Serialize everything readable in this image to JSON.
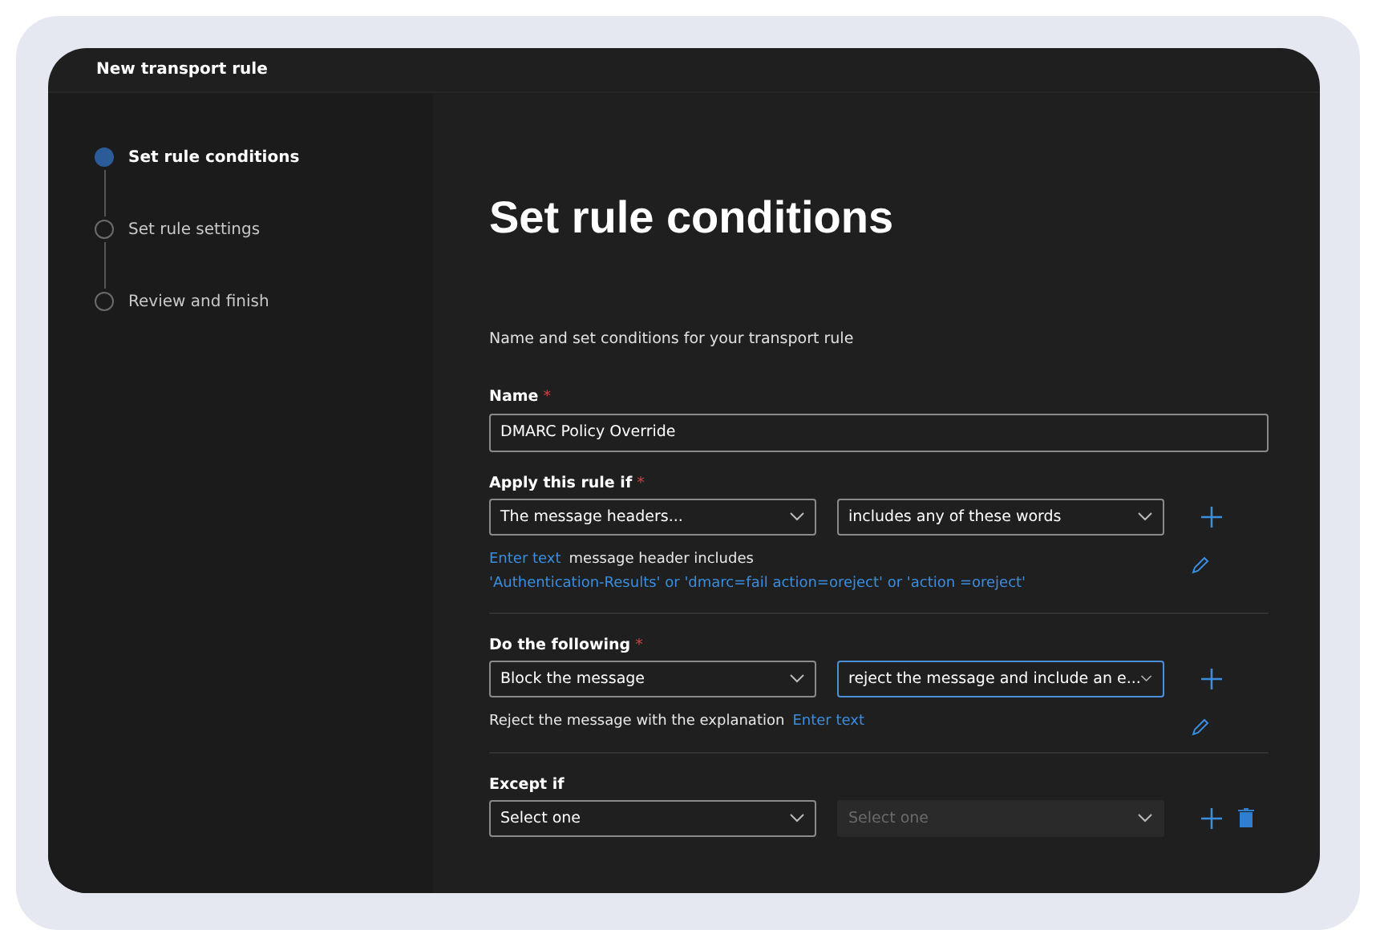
{
  "window": {
    "title": "New transport rule"
  },
  "steps": [
    {
      "label": "Set rule conditions",
      "selected": true
    },
    {
      "label": "Set rule settings",
      "selected": false
    },
    {
      "label": "Review and finish",
      "selected": false
    }
  ],
  "page": {
    "heading": "Set rule conditions",
    "description": "Name and set conditions for your transport rule"
  },
  "name_field": {
    "label": "Name",
    "required_mark": "*",
    "value": "DMARC Policy Override"
  },
  "sections": [
    {
      "label": "Apply this rule if",
      "required_mark": "*",
      "edit_icon": true,
      "icons": [
        {
          "kind": "add"
        }
      ],
      "dropdowns": [
        {
          "value": "The message headers...",
          "focused": false,
          "disabled": false
        },
        {
          "value": "includes any of these words",
          "focused": false,
          "disabled": false
        }
      ],
      "detail_lines": [
        [
          {
            "text": "Enter text",
            "link": true
          },
          {
            "text": "message header includes",
            "link": false
          }
        ],
        [
          {
            "text": "'Authentication-Results' or 'dmarc=fail action=oreject' or 'action =oreject'",
            "link": true
          }
        ]
      ]
    },
    {
      "label": "Do the following",
      "required_mark": "*",
      "edit_icon": true,
      "icons": [
        {
          "kind": "add"
        }
      ],
      "dropdowns": [
        {
          "value": "Block the message",
          "focused": false,
          "disabled": false
        },
        {
          "value": "reject the message and include an e...",
          "focused": true,
          "disabled": false
        }
      ],
      "detail_lines": [
        [
          {
            "text": "Reject the message with the explanation",
            "link": false
          },
          {
            "text": "Enter text",
            "link": true
          }
        ]
      ]
    },
    {
      "label": "Except if",
      "icons": [
        {
          "kind": "add"
        },
        {
          "kind": "delete"
        }
      ],
      "dropdowns": [
        {
          "value": "Select one",
          "focused": false,
          "disabled": false
        },
        {
          "placeholder": "Select one",
          "focused": false,
          "disabled": true
        }
      ]
    }
  ]
}
